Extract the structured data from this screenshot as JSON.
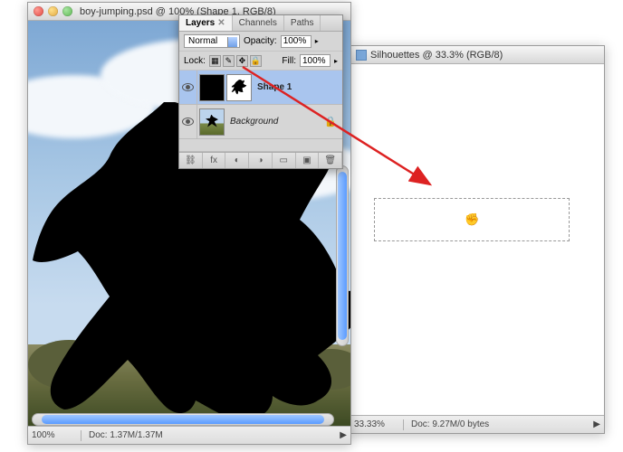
{
  "window1": {
    "title": "boy-jumping.psd @ 100% (Shape 1, RGB/8)",
    "zoom": "100%",
    "doc_info": "Doc: 1.37M/1.37M"
  },
  "window2": {
    "title": "Silhouettes @ 33.3% (RGB/8)",
    "zoom": "33.33%",
    "doc_info": "Doc: 9.27M/0 bytes"
  },
  "panel": {
    "tabs": {
      "layers": "Layers",
      "channels": "Channels",
      "paths": "Paths"
    },
    "blend_mode": "Normal",
    "opacity_label": "Opacity:",
    "opacity_value": "100%",
    "lock_label": "Lock:",
    "fill_label": "Fill:",
    "fill_value": "100%",
    "layers": [
      {
        "name": "Shape 1"
      },
      {
        "name": "Background"
      }
    ],
    "lock_icons": {
      "pixels": "▦",
      "position": "✎",
      "move": "✥",
      "all": "🔒"
    },
    "footer_icons": {
      "link": "⛓",
      "fx": "fx",
      "mask": "◐",
      "adjust": "◑",
      "group": "▭",
      "new": "▣",
      "trash": "🗑"
    }
  },
  "icons": {
    "drag_cursor": "✊",
    "arrow_right": "▶"
  }
}
